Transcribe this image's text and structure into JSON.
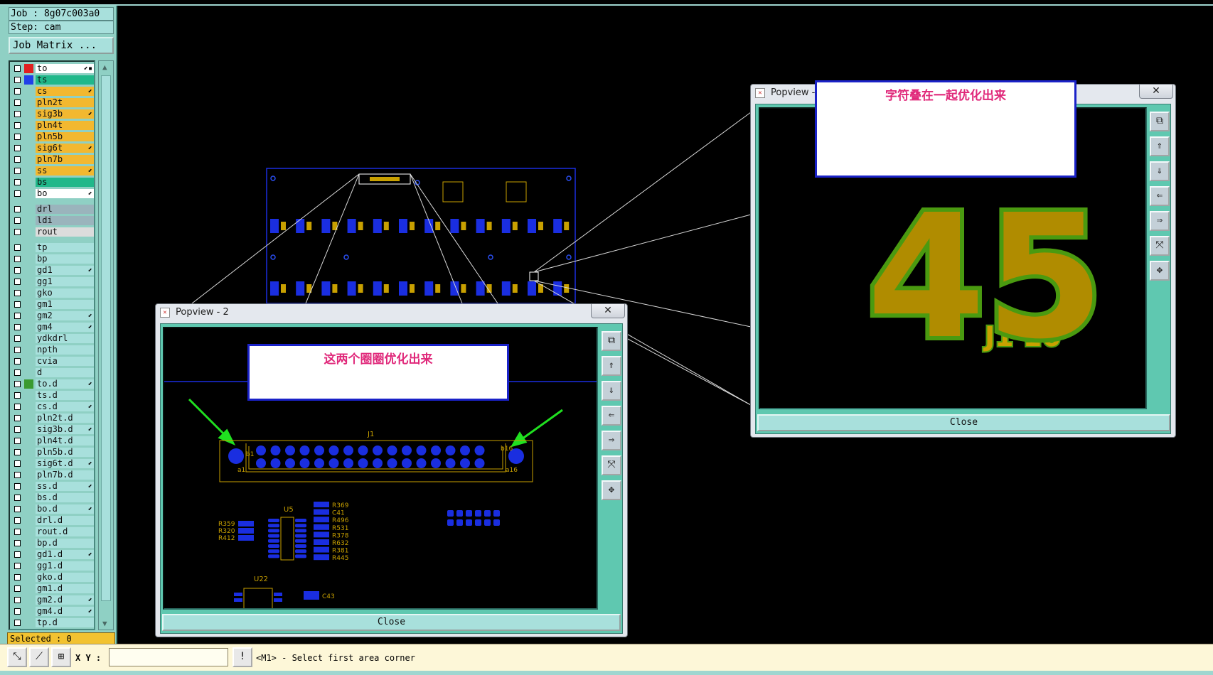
{
  "job": {
    "job_label": "Job : 8g07c003a0",
    "step_label": "Step: cam",
    "matrix_button": "Job Matrix ..."
  },
  "layers": [
    {
      "name": "to",
      "color": "#ffffff",
      "swatch": "#e02020",
      "mark": "⬋▪"
    },
    {
      "name": "ts",
      "color": "#20b88a",
      "swatch": "#2040e8",
      "mark": ""
    },
    {
      "name": "cs",
      "color": "#f2b830",
      "swatch": "",
      "mark": "⬋"
    },
    {
      "name": "pln2t",
      "color": "#f2b830",
      "swatch": "",
      "mark": ""
    },
    {
      "name": "sig3b",
      "color": "#f2b830",
      "swatch": "",
      "mark": "⬋"
    },
    {
      "name": "pln4t",
      "color": "#f2b830",
      "swatch": "",
      "mark": ""
    },
    {
      "name": "pln5b",
      "color": "#f2b830",
      "swatch": "",
      "mark": ""
    },
    {
      "name": "sig6t",
      "color": "#f2b830",
      "swatch": "",
      "mark": "⬋"
    },
    {
      "name": "pln7b",
      "color": "#f2b830",
      "swatch": "",
      "mark": ""
    },
    {
      "name": "ss",
      "color": "#f2b830",
      "swatch": "",
      "mark": "⬋"
    },
    {
      "name": "bs",
      "color": "#20b88a",
      "swatch": "",
      "mark": ""
    },
    {
      "name": "bo",
      "color": "#ffffff",
      "swatch": "",
      "mark": "⬋"
    },
    {
      "name": "drl",
      "color": "#9ab4bc",
      "swatch": "",
      "mark": ""
    },
    {
      "name": "ldi",
      "color": "#9ab4bc",
      "swatch": "",
      "mark": ""
    },
    {
      "name": "rout",
      "color": "#dcdcdc",
      "swatch": "",
      "mark": ""
    },
    {
      "name": "tp",
      "color": "#a8e0dc",
      "swatch": "",
      "mark": ""
    },
    {
      "name": "bp",
      "color": "#a8e0dc",
      "swatch": "",
      "mark": ""
    },
    {
      "name": "gd1",
      "color": "#a8e0dc",
      "swatch": "",
      "mark": "⬋"
    },
    {
      "name": "gg1",
      "color": "#a8e0dc",
      "swatch": "",
      "mark": ""
    },
    {
      "name": "gko",
      "color": "#a8e0dc",
      "swatch": "",
      "mark": ""
    },
    {
      "name": "gm1",
      "color": "#a8e0dc",
      "swatch": "",
      "mark": ""
    },
    {
      "name": "gm2",
      "color": "#a8e0dc",
      "swatch": "",
      "mark": "⬋"
    },
    {
      "name": "gm4",
      "color": "#a8e0dc",
      "swatch": "",
      "mark": "⬋"
    },
    {
      "name": "ydkdrl",
      "color": "#a8e0dc",
      "swatch": "",
      "mark": ""
    },
    {
      "name": "npth",
      "color": "#a8e0dc",
      "swatch": "",
      "mark": ""
    },
    {
      "name": "cvia",
      "color": "#a8e0dc",
      "swatch": "",
      "mark": ""
    },
    {
      "name": "d",
      "color": "#a8e0dc",
      "swatch": "",
      "mark": ""
    },
    {
      "name": "to.d",
      "color": "#a8e0dc",
      "swatch": "#3a9a30",
      "mark": "⬋"
    },
    {
      "name": "ts.d",
      "color": "#a8e0dc",
      "swatch": "",
      "mark": ""
    },
    {
      "name": "cs.d",
      "color": "#a8e0dc",
      "swatch": "",
      "mark": "⬋"
    },
    {
      "name": "pln2t.d",
      "color": "#a8e0dc",
      "swatch": "",
      "mark": ""
    },
    {
      "name": "sig3b.d",
      "color": "#a8e0dc",
      "swatch": "",
      "mark": "⬋"
    },
    {
      "name": "pln4t.d",
      "color": "#a8e0dc",
      "swatch": "",
      "mark": ""
    },
    {
      "name": "pln5b.d",
      "color": "#a8e0dc",
      "swatch": "",
      "mark": ""
    },
    {
      "name": "sig6t.d",
      "color": "#a8e0dc",
      "swatch": "",
      "mark": "⬋"
    },
    {
      "name": "pln7b.d",
      "color": "#a8e0dc",
      "swatch": "",
      "mark": ""
    },
    {
      "name": "ss.d",
      "color": "#a8e0dc",
      "swatch": "",
      "mark": "⬋"
    },
    {
      "name": "bs.d",
      "color": "#a8e0dc",
      "swatch": "",
      "mark": ""
    },
    {
      "name": "bo.d",
      "color": "#a8e0dc",
      "swatch": "",
      "mark": "⬋"
    },
    {
      "name": "drl.d",
      "color": "#a8e0dc",
      "swatch": "",
      "mark": ""
    },
    {
      "name": "rout.d",
      "color": "#a8e0dc",
      "swatch": "",
      "mark": ""
    },
    {
      "name": "bp.d",
      "color": "#a8e0dc",
      "swatch": "",
      "mark": ""
    },
    {
      "name": "gd1.d",
      "color": "#a8e0dc",
      "swatch": "",
      "mark": "⬋"
    },
    {
      "name": "gg1.d",
      "color": "#a8e0dc",
      "swatch": "",
      "mark": ""
    },
    {
      "name": "gko.d",
      "color": "#a8e0dc",
      "swatch": "",
      "mark": ""
    },
    {
      "name": "gm1.d",
      "color": "#a8e0dc",
      "swatch": "",
      "mark": ""
    },
    {
      "name": "gm2.d",
      "color": "#a8e0dc",
      "swatch": "",
      "mark": "⬋"
    },
    {
      "name": "gm4.d",
      "color": "#a8e0dc",
      "swatch": "",
      "mark": "⬋"
    },
    {
      "name": "tp.d",
      "color": "#a8e0dc",
      "swatch": "",
      "mark": ""
    }
  ],
  "selected_label": "Selected : 0",
  "bottombar": {
    "xy_label": "X Y :",
    "xy_value": "",
    "warn_icon": "!",
    "status": "<M1> - Select first area corner",
    "tool_icons": [
      "zoom-area-icon",
      "measure-icon",
      "grid-snap-icon"
    ]
  },
  "popview1": {
    "title": "Popview - 1",
    "close_label": "Close",
    "note": "字符叠在一起优化出来",
    "silk_number": "45",
    "silk_suffix": "J1 16",
    "tool_icons": [
      "zoom-fit-icon",
      "pan-up-icon",
      "pan-down-icon",
      "pan-left-icon",
      "pan-right-icon",
      "zoom-out-icon",
      "zoom-in-icon"
    ]
  },
  "popview2": {
    "title": "Popview - 2",
    "close_label": "Close",
    "note": "这两个圈圈优化出来",
    "refdes": {
      "J1": "J1",
      "b1": "b1",
      "a1": "a1",
      "b16": "b16",
      "a16": "a16",
      "U5": "U5",
      "U22": "U22",
      "left_group": [
        "R359",
        "R320",
        "R412"
      ],
      "right_group": [
        "R369",
        "C41",
        "R496",
        "R531",
        "R378",
        "R632",
        "R381",
        "R445"
      ],
      "bottom": "C43"
    }
  },
  "colors": {
    "panel": "#8fd0c4",
    "silk": "#c8a000",
    "pad": "#1a2ee0",
    "silk_outline": "#4a9a10",
    "note_text": "#e0287a",
    "arrow": "#20e020"
  }
}
